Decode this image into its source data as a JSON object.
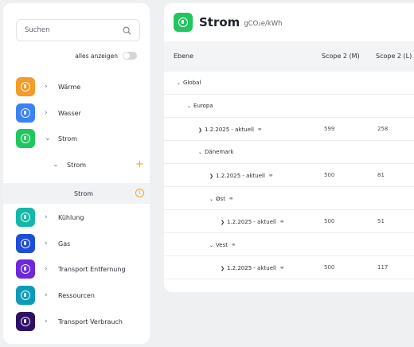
{
  "sidebar": {
    "search_placeholder": "Suchen",
    "show_all_label": "alles anzeigen",
    "items": [
      {
        "label": "Wärme",
        "color": "#f39c2a",
        "icon": "thermometer-icon"
      },
      {
        "label": "Wasser",
        "color": "#3b82f6",
        "icon": "water-drop-icon"
      },
      {
        "label": "Strom",
        "color": "#22c55e",
        "icon": "lightbulb-icon"
      },
      {
        "label": "Kühlung",
        "color": "#14b8a6",
        "icon": "snowflake-icon"
      },
      {
        "label": "Gas",
        "color": "#1d4ed8",
        "icon": "flame-icon"
      },
      {
        "label": "Transport Entfernung",
        "color": "#6d28d9",
        "icon": "truck-icon"
      },
      {
        "label": "Ressourcen",
        "color": "#0e9bb8",
        "icon": "box-icon"
      },
      {
        "label": "Transport Verbrauch",
        "color": "#2e1065",
        "icon": "truck-icon"
      }
    ],
    "sub_item": "Strom",
    "selected_item": "Strom"
  },
  "main": {
    "title": "Strom",
    "unit": "gCO₂e/kWh",
    "columns": [
      "Ebene",
      "Scope 2 (M)",
      "Scope 2 (L)"
    ],
    "rows": [
      {
        "name": "Global",
        "v1": "",
        "v2": ""
      },
      {
        "name": "Europa",
        "v1": "",
        "v2": ""
      },
      {
        "name": "1.2.2025 - aktuell",
        "v1": "599",
        "v2": "258"
      },
      {
        "name": "Dänemark",
        "v1": "",
        "v2": ""
      },
      {
        "name": "1.2.2025 - aktuell",
        "v1": "500",
        "v2": "81"
      },
      {
        "name": "Øst",
        "v1": "",
        "v2": ""
      },
      {
        "name": "1.2.2025 - aktuell",
        "v1": "500",
        "v2": "51"
      },
      {
        "name": "Vest",
        "v1": "",
        "v2": ""
      },
      {
        "name": "1.2.2025 - aktuell",
        "v1": "500",
        "v2": "117"
      }
    ]
  }
}
